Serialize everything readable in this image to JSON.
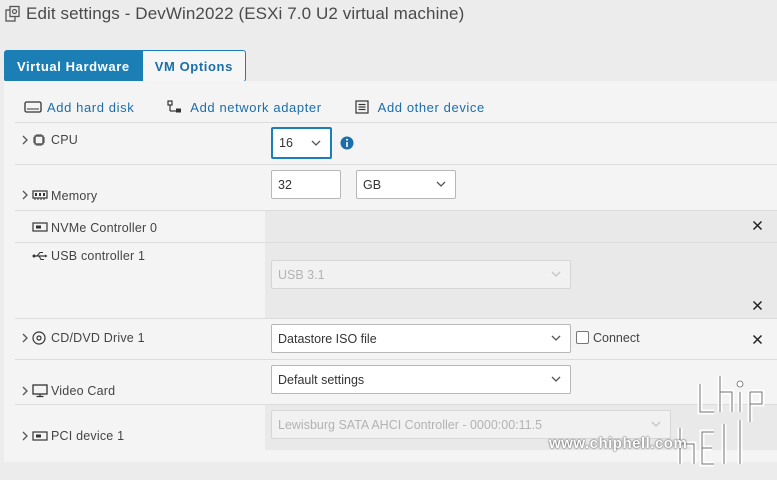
{
  "window": {
    "title": "Edit settings - DevWin2022 (ESXi 7.0 U2 virtual machine)",
    "title_icon": "vm-settings-icon"
  },
  "tabs": [
    {
      "label": "Virtual Hardware",
      "active": true
    },
    {
      "label": "VM Options",
      "active": false
    }
  ],
  "toolbar": {
    "add_hard_disk": "Add hard disk",
    "add_network_adapter": "Add network adapter",
    "add_other_device": "Add other device"
  },
  "devices": {
    "cpu": {
      "label": "CPU",
      "value": "16"
    },
    "memory": {
      "label": "Memory",
      "value": "32",
      "unit": "GB"
    },
    "nvme": {
      "label": "NVMe Controller 0"
    },
    "usb": {
      "label": "USB controller 1",
      "value": "USB 3.1"
    },
    "cddvd": {
      "label": "CD/DVD Drive 1",
      "value": "Datastore ISO file",
      "connect_label": "Connect"
    },
    "video": {
      "label": "Video Card",
      "value": "Default settings"
    },
    "pci": {
      "label": "PCI device 1",
      "value": "Lewisburg SATA AHCI Controller - 0000:00:11.5"
    }
  },
  "watermark": {
    "url": "www.chiphell.com"
  },
  "colors": {
    "accent": "#1b7eb4",
    "link": "#1b6ea8"
  }
}
